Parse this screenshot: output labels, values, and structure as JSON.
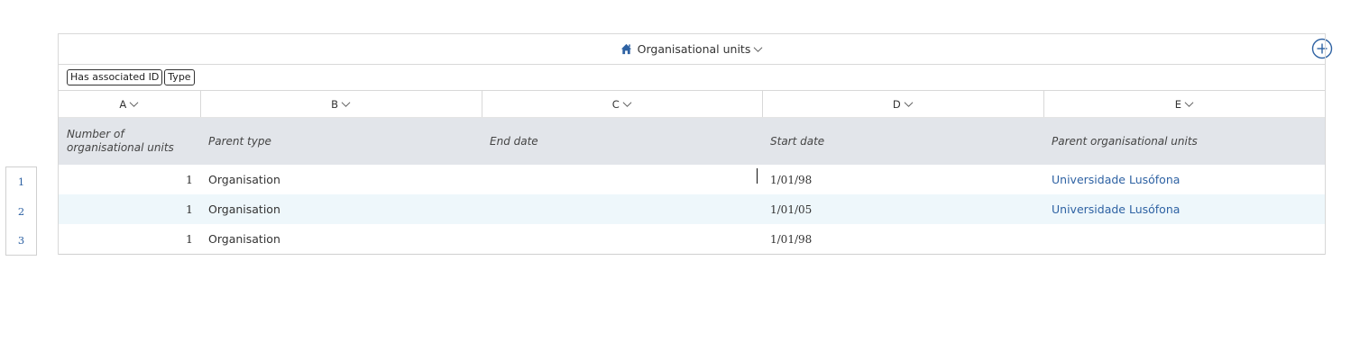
{
  "panel": {
    "title": "Organisational units"
  },
  "filters": [
    "Has associated ID",
    "Type"
  ],
  "column_letters": [
    "A",
    "B",
    "C",
    "D",
    "E"
  ],
  "column_headers": [
    "Number of organisational units",
    "Parent type",
    "End date",
    "Start date",
    "Parent organisational units"
  ],
  "row_numbers": [
    "1",
    "2",
    "3"
  ],
  "rows": [
    {
      "count": "1",
      "parent_type": "Organisation",
      "end_date": "",
      "start_date": "1/01/98",
      "parent_units": "Universidade Lusófona"
    },
    {
      "count": "1",
      "parent_type": "Organisation",
      "end_date": "",
      "start_date": "1/01/05",
      "parent_units": "Universidade Lusófona"
    },
    {
      "count": "1",
      "parent_type": "Organisation",
      "end_date": "",
      "start_date": "1/01/98",
      "parent_units": ""
    }
  ],
  "colors": {
    "accent": "#2e62a3",
    "header_bg": "#e2e5ea",
    "alt_row_bg": "#eef7fb"
  },
  "icons": {
    "title": "home-icon",
    "add": "plus-circle-icon",
    "column_menu": "chevron-down-icon"
  }
}
